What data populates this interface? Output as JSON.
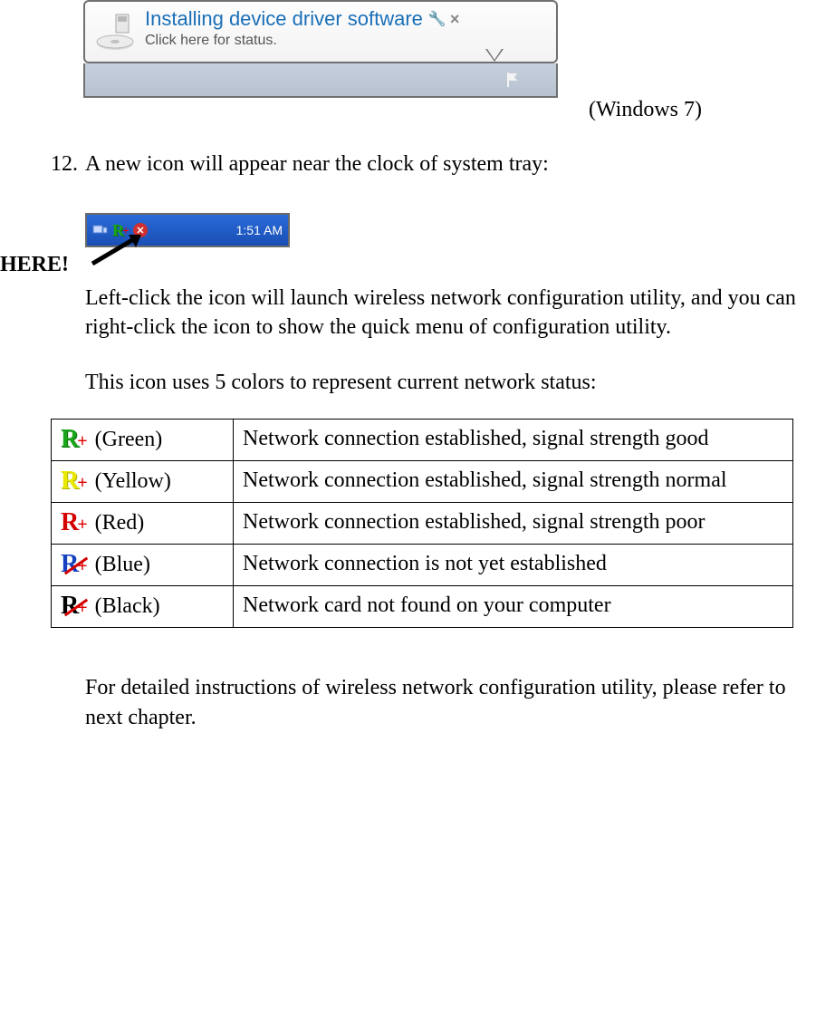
{
  "win7_balloon": {
    "title": "Installing device driver software",
    "subtitle": "Click here for status.",
    "os_label": "(Windows 7)"
  },
  "step": {
    "number": "12.",
    "text": "A new icon will appear near the clock of system tray:"
  },
  "tray": {
    "clock": "1:51 AM"
  },
  "here_label": "HERE!",
  "body_paragraph": "Left-click the icon will launch wireless network configuration utility, and you can right-click the icon to show the quick menu of configuration utility.",
  "status_intro": "This icon uses 5 colors to represent current network status:",
  "status_rows": [
    {
      "color_label": "(Green)",
      "description": "Network connection established, signal strength good"
    },
    {
      "color_label": "(Yellow)",
      "description": "Network connection established, signal strength normal"
    },
    {
      "color_label": "(Red)",
      "description": "Network connection established, signal strength poor"
    },
    {
      "color_label": "(Blue)",
      "description": "Network connection is not yet established"
    },
    {
      "color_label": "(Black)",
      "description": "Network card not found on your computer"
    }
  ],
  "footer": "For detailed instructions of wireless network configuration utility, please refer to next chapter."
}
